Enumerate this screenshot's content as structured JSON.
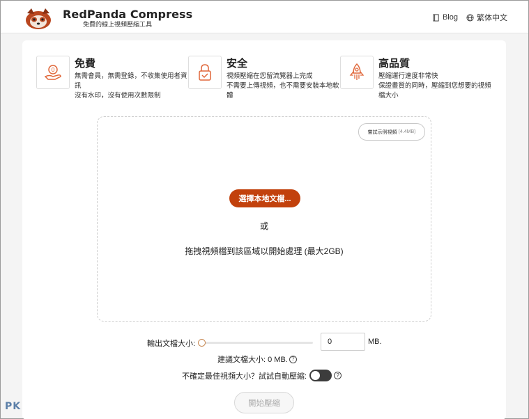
{
  "header": {
    "title": "RedPanda Compress",
    "subtitle": "免費的線上視頻壓縮工具",
    "nav": [
      {
        "label": "Blog",
        "icon": "book-icon"
      },
      {
        "label": "繁体中文",
        "icon": "globe-icon"
      }
    ]
  },
  "features": [
    {
      "title": "免費",
      "desc": "無需會員，無需登錄，不收集使用者資訊\n沒有水印，沒有使用次數限制",
      "icon": "free-hand-icon"
    },
    {
      "title": "安全",
      "desc": "視頻壓縮在您留流覽器上完成\n不需要上傳視頻，也不需要安裝本地軟體",
      "icon": "lock-icon"
    },
    {
      "title": "高品質",
      "desc": "壓縮運行速度非常快\n保證畫質的同時，壓縮到您想要的視頻檔大小",
      "icon": "rocket-icon"
    }
  ],
  "dropzone": {
    "sample_label": "嘗試示例視頻",
    "sample_size": "(4.4MB)",
    "select_button": "選擇本地文檔...",
    "or_text": "或",
    "drag_text": "拖拽視頻檔到該區域以開始處理 (最大2GB)"
  },
  "output": {
    "label": "輸出文檔大小:",
    "slider_value": 0,
    "input_value": "0",
    "unit": "MB.",
    "suggest_label": "建議文檔大小: 0 MB.",
    "help_glyph": "?"
  },
  "auto": {
    "label": "不確定最佳視頻大小？試試自動壓縮:",
    "enabled": false
  },
  "start_button": "開始壓縮",
  "watermark": "PK",
  "colors": {
    "accent": "#c2410c",
    "icon_accent": "#e0673a"
  }
}
